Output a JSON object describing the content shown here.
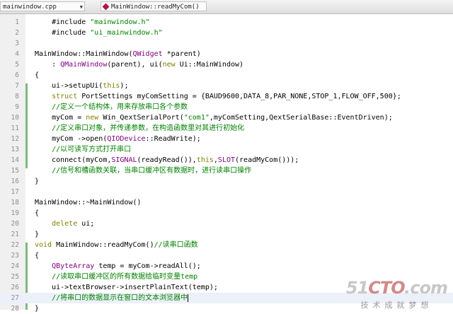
{
  "toolbar": {
    "file_combo": "mainwindow.cpp",
    "function_combo": "MainWindow::readMyCom()"
  },
  "editor": {
    "current_line": 27,
    "lines": [
      {
        "n": 1,
        "segs": [
          [
            "",
            "    #include "
          ],
          [
            "str",
            "\"mainwindow.h\""
          ]
        ]
      },
      {
        "n": 2,
        "segs": [
          [
            "",
            "    #include "
          ],
          [
            "str",
            "\"ui_mainwindow.h\""
          ]
        ]
      },
      {
        "n": 3,
        "segs": []
      },
      {
        "n": 4,
        "segs": [
          [
            "",
            "MainWindow::MainWindow("
          ],
          [
            "qt",
            "QWidget"
          ],
          [
            "",
            " *parent)"
          ]
        ]
      },
      {
        "n": 5,
        "segs": [
          [
            "",
            "    : "
          ],
          [
            "qt",
            "QMainWindow"
          ],
          [
            "",
            "(parent), ui("
          ],
          [
            "kw",
            "new"
          ],
          [
            "",
            " Ui::MainWindow)"
          ]
        ]
      },
      {
        "n": 6,
        "segs": [
          [
            "",
            "{"
          ]
        ]
      },
      {
        "n": 7,
        "segs": [
          [
            "",
            "    ui->setupUi("
          ],
          [
            "kw",
            "this"
          ],
          [
            "",
            ");"
          ]
        ]
      },
      {
        "n": 8,
        "segs": [
          [
            "",
            "    "
          ],
          [
            "kw",
            "struct"
          ],
          [
            "",
            " PortSettings myComSetting = {BAUD9600,DATA_8,PAR_NONE,STOP_1,FLOW_OFF,500};"
          ]
        ]
      },
      {
        "n": 9,
        "segs": [
          [
            "cm",
            "    //定义一个结构体，用来存放串口各个参数"
          ]
        ]
      },
      {
        "n": 10,
        "segs": [
          [
            "",
            "    myCom = "
          ],
          [
            "kw",
            "new"
          ],
          [
            "",
            " Win_QextSerialPort("
          ],
          [
            "str",
            "\"com1\""
          ],
          [
            "",
            ",myComSetting,QextSerialBase::EventDriven);"
          ]
        ]
      },
      {
        "n": 11,
        "segs": [
          [
            "cm",
            "    //定义串口对象，并传递参数，在构造函数里对其进行初始化"
          ]
        ]
      },
      {
        "n": 12,
        "segs": [
          [
            "",
            "    myCom ->open("
          ],
          [
            "qt",
            "QIODevice"
          ],
          [
            "",
            "::ReadWrite);"
          ]
        ]
      },
      {
        "n": 13,
        "segs": [
          [
            "cm",
            "    //以可读写方式打开串口"
          ]
        ]
      },
      {
        "n": 14,
        "segs": [
          [
            "",
            "    connect(myCom,"
          ],
          [
            "qt",
            "SIGNAL"
          ],
          [
            "",
            "(readyRead()),"
          ],
          [
            "kw",
            "this"
          ],
          [
            "",
            ","
          ],
          [
            "qt",
            "SLOT"
          ],
          [
            "",
            "(readMyCom()));"
          ]
        ]
      },
      {
        "n": 15,
        "segs": [
          [
            "cm",
            "    //信号和槽函数关联，当串口缓冲区有数据时，进行读串口操作"
          ]
        ]
      },
      {
        "n": 16,
        "segs": [
          [
            "",
            "}"
          ]
        ]
      },
      {
        "n": 17,
        "segs": []
      },
      {
        "n": 18,
        "segs": [
          [
            "",
            "MainWindow::~MainWindow()"
          ]
        ]
      },
      {
        "n": 19,
        "segs": [
          [
            "",
            "{"
          ]
        ]
      },
      {
        "n": 20,
        "segs": [
          [
            "",
            "    "
          ],
          [
            "kw",
            "delete"
          ],
          [
            "",
            " ui;"
          ]
        ]
      },
      {
        "n": 21,
        "segs": [
          [
            "",
            "}"
          ]
        ]
      },
      {
        "n": 22,
        "segs": [
          [
            "kw",
            "void"
          ],
          [
            "",
            " MainWindow::readMyCom()"
          ],
          [
            "cm",
            "//读串口函数"
          ]
        ]
      },
      {
        "n": 23,
        "segs": [
          [
            "",
            "{"
          ]
        ]
      },
      {
        "n": 24,
        "segs": [
          [
            "",
            "    "
          ],
          [
            "qt",
            "QByteArray"
          ],
          [
            "",
            " temp = myCom->readAll();"
          ]
        ]
      },
      {
        "n": 25,
        "segs": [
          [
            "cm",
            "    //读取串口缓冲区的所有数据给临时变量temp"
          ]
        ]
      },
      {
        "n": 26,
        "segs": [
          [
            "",
            "    ui->textBrowser->insertPlainText(temp);"
          ]
        ]
      },
      {
        "n": 27,
        "segs": [
          [
            "cm",
            "    //将串口的数据显示在窗口的文本浏览器中"
          ]
        ]
      },
      {
        "n": 28,
        "segs": [
          [
            "",
            "}"
          ]
        ]
      }
    ]
  },
  "watermark": {
    "logo_a": "51",
    "logo_b": "CTO",
    "logo_c": ".com",
    "tagline": "技术成就梦想"
  }
}
